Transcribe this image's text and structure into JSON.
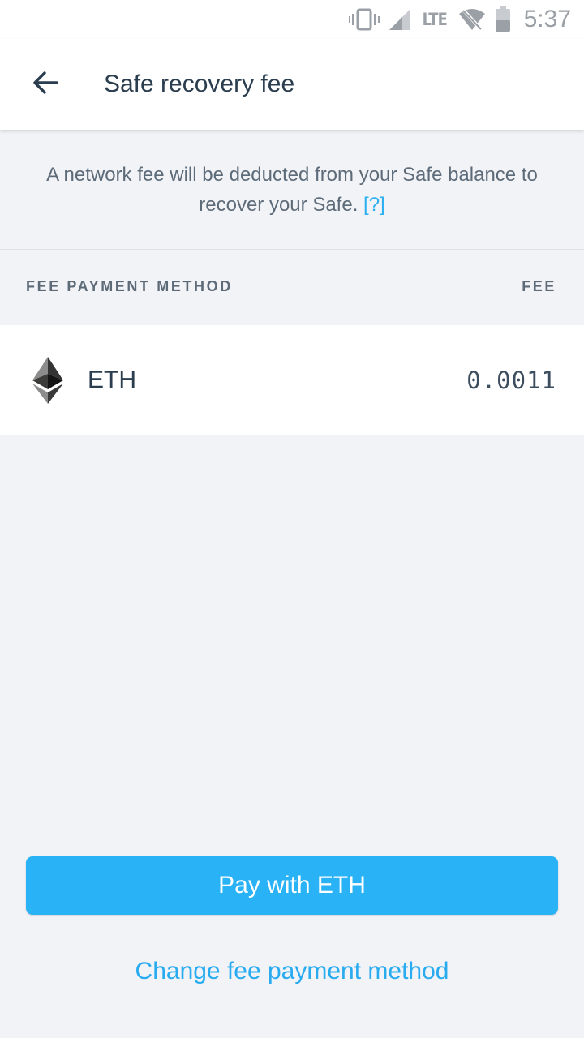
{
  "status_bar": {
    "icons": [
      "vibrate-icon",
      "signal-icon",
      "wifi-off-icon",
      "battery-icon"
    ],
    "network_label": "LTE",
    "time": "5:37"
  },
  "app_bar": {
    "back_icon": "arrow-left-icon",
    "title": "Safe recovery fee"
  },
  "info": {
    "message": "A network fee will be deducted from your Safe balance to recover your Safe.",
    "help_link": "[?]"
  },
  "table_header": {
    "method_label": "FEE PAYMENT METHOD",
    "fee_label": "FEE"
  },
  "fee_rows": [
    {
      "icon": "ethereum-icon",
      "token": "ETH",
      "fee": "0.0011"
    }
  ],
  "actions": {
    "pay_button": "Pay with ETH",
    "change_link": "Change fee payment method"
  },
  "colors": {
    "accent": "#29b3f6",
    "link": "#2ab0f0",
    "background": "#f2f3f7",
    "text_primary": "#2b3e50",
    "text_secondary": "#5d6b79"
  }
}
